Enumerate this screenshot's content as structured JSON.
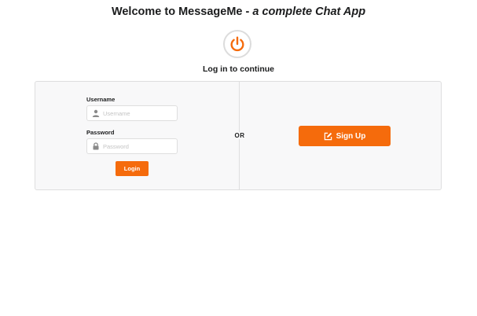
{
  "header": {
    "title": "Welcome to MessageMe - ",
    "subtitle": "a complete Chat App"
  },
  "power_icon": "power-icon",
  "subheading": "Log in to continue",
  "login_form": {
    "username_label": "Username",
    "username_placeholder": "Username",
    "username_value": "",
    "username_icon": "user-icon",
    "password_label": "Password",
    "password_placeholder": "Password",
    "password_value": "",
    "password_icon": "lock-icon",
    "login_label": "Login"
  },
  "divider_label": "OR",
  "signup": {
    "label": "Sign Up",
    "icon": "edit-icon"
  },
  "colors": {
    "accent": "#f56b0c",
    "segment_bg": "#f8f8f9",
    "border": "#dededf"
  }
}
